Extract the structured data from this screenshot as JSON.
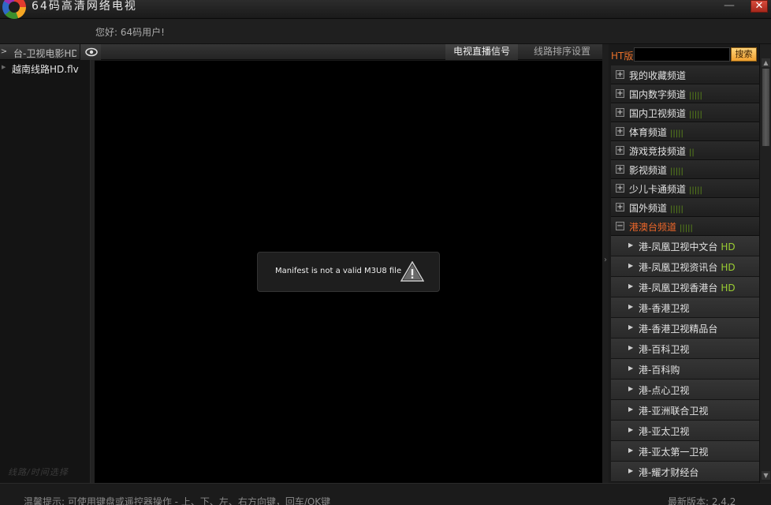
{
  "window": {
    "title": "64码高清网络电视",
    "minimize": "—",
    "close": "✕"
  },
  "header": {
    "greeting": "您好: 64码用户!"
  },
  "left_panel": {
    "header_label": "台-卫视电影HD",
    "items": [
      {
        "label": "越南线路HD.flv"
      }
    ],
    "footer": "线路/时间选择"
  },
  "tabs": [
    {
      "label": "电视直播信号",
      "active": true
    },
    {
      "label": "线路排序设置",
      "active": false
    }
  ],
  "player": {
    "error_message": "Manifest is not a valid M3U8 file",
    "error_icon": "warning-icon"
  },
  "search": {
    "prefix": "HT版",
    "placeholder": "",
    "button": "搜索"
  },
  "categories": [
    {
      "label": "我的收藏频道",
      "signal": "",
      "expanded": false
    },
    {
      "label": "国内数字频道",
      "signal": "|||||",
      "expanded": false
    },
    {
      "label": "国内卫视频道",
      "signal": "|||||",
      "expanded": false
    },
    {
      "label": "体育频道",
      "signal": "|||||",
      "expanded": false
    },
    {
      "label": "游戏竞技频道",
      "signal": "||",
      "expanded": false
    },
    {
      "label": "影视频道",
      "signal": "|||||",
      "expanded": false
    },
    {
      "label": "少儿卡通频道",
      "signal": "|||||",
      "expanded": false
    },
    {
      "label": "国外频道",
      "signal": "|||||",
      "expanded": false
    },
    {
      "label": "港澳台频道",
      "signal": "|||||",
      "expanded": true
    }
  ],
  "channels": [
    {
      "label": "港-凤凰卫视中文台",
      "hd": "HD"
    },
    {
      "label": "港-凤凰卫视资讯台",
      "hd": "HD"
    },
    {
      "label": "港-凤凰卫视香港台",
      "hd": "HD"
    },
    {
      "label": "港-香港卫视",
      "hd": ""
    },
    {
      "label": "港-香港卫视精品台",
      "hd": ""
    },
    {
      "label": "港-百科卫视",
      "hd": ""
    },
    {
      "label": "港-百科购",
      "hd": ""
    },
    {
      "label": "港-点心卫视",
      "hd": ""
    },
    {
      "label": "港-亚洲联合卫视",
      "hd": ""
    },
    {
      "label": "港-亚太卫视",
      "hd": ""
    },
    {
      "label": "港-亚太第一卫视",
      "hd": ""
    },
    {
      "label": "港-耀才财经台",
      "hd": ""
    }
  ],
  "status": {
    "hint": "温馨提示:  可使用键盘或遥控器操作 - 上、下、左、右方向键，回车/OK键",
    "version": "最新版本:  2.4.2"
  },
  "colors": {
    "accent_orange": "#f0682a",
    "hd_green": "#9acd32",
    "search_button": "#f0a030"
  }
}
